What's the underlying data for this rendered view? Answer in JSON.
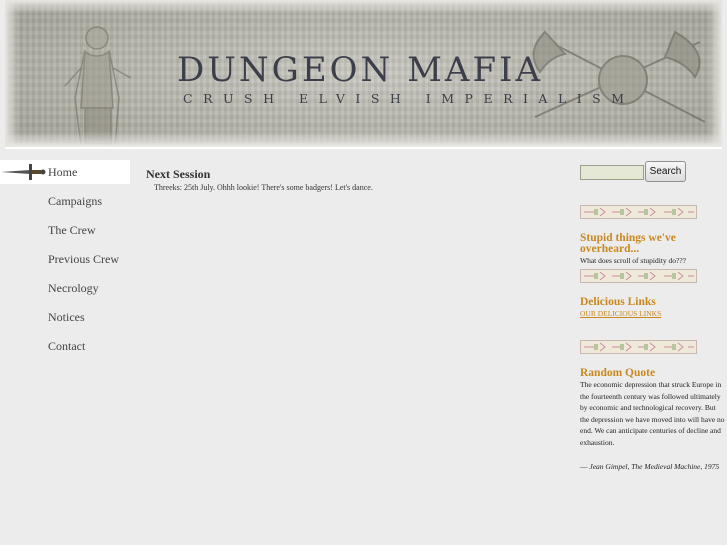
{
  "site": {
    "title": "DUNGEON MAFIA",
    "tagline": "CRUSH ELVISH IMPERIALISM"
  },
  "nav": {
    "items": [
      {
        "label": "Home",
        "active": true
      },
      {
        "label": "Campaigns"
      },
      {
        "label": "The Crew"
      },
      {
        "label": "Previous Crew"
      },
      {
        "label": "Necrology"
      },
      {
        "label": "Notices"
      },
      {
        "label": "Contact"
      }
    ]
  },
  "main": {
    "heading": "Next Session",
    "text": "Threeks: 25th July. Ohhh lookie! There's some badgers! Let's dance."
  },
  "sidebar": {
    "search": {
      "value": "",
      "placeholder": "",
      "button_label": "Search"
    },
    "stupid": {
      "title": "Stupid things we've overheard...",
      "text": "What does scroll of stupidity do???"
    },
    "links": {
      "title": "Delicious Links",
      "link_label": "OUR DELICIOUS LINKS"
    },
    "quote": {
      "title": "Random Quote",
      "text": "The economic depression that struck Europe in the fourteenth century was followed ultimately by economic and technological recovery. But the depression we have moved into will have no end. We can anticipate centuries of decline and exhaustion.",
      "dash": "—",
      "author": "Jean Gimpel",
      "source": ", The Medieval Machine, 1975"
    }
  },
  "colors": {
    "accent": "#c9881f",
    "background": "#ececec",
    "title_text": "#3c3f4a"
  },
  "icons": {
    "nav_marker": "sword-icon",
    "divider": "ornamental-divider"
  }
}
